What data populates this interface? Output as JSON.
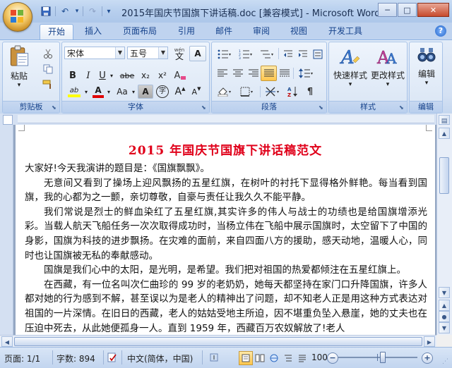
{
  "window": {
    "title": "2015年国庆节国旗下讲话稿.doc [兼容模式] - Microsoft Word",
    "min_glyph": "─",
    "max_glyph": "□",
    "close_glyph": "✕"
  },
  "qat": {
    "save": "💾",
    "undo": "↶",
    "undo_dd": "▾",
    "redo": "↷",
    "custom": "▾"
  },
  "tabs": [
    "开始",
    "插入",
    "页面布局",
    "引用",
    "邮件",
    "审阅",
    "视图",
    "开发工具"
  ],
  "help_glyph": "?",
  "ribbon": {
    "clipboard": {
      "label": "剪贴板",
      "paste": "粘贴",
      "paste_dd": "▾"
    },
    "font": {
      "label": "字体",
      "font_name": "宋体",
      "font_size": "五号",
      "bold": "B",
      "italic": "I",
      "underline": "U",
      "strike": "abe",
      "subscript": "x₂",
      "superscript": "x²",
      "clear": "A",
      "phonetic": "wén",
      "char_border": "A",
      "highlight": "ab",
      "font_color": "A",
      "case": "Aa",
      "char_shade": "A",
      "enclose": "字",
      "grow": "A",
      "shrink": "A"
    },
    "paragraph": {
      "label": "段落"
    },
    "styles": {
      "label": "样式",
      "quick_styles": "快速样式",
      "change_styles": "更改样式"
    },
    "editing": {
      "label": "编辑",
      "edit": "编辑"
    }
  },
  "document": {
    "title": "2015 年国庆节国旗下讲话稿范文",
    "paragraphs": [
      {
        "text": "大家好!今天我演讲的题目是：《国旗飘飘》。",
        "indent": false
      },
      {
        "text": "无意间又看到了操场上迎风飘扬的五星红旗，在树叶的衬托下显得格外鲜艳。每当看到国旗，我的心都为之一颤，亲切尊敬，自豪与责任让我久久不能平静。",
        "indent": true
      },
      {
        "text": "我们常说是烈士的鲜血染红了五星红旗,其实许多的伟人与战士的功绩也是给国旗增添光彩。当载人航天飞船任务一次次取得成功时，当杨立伟在飞船中展示国旗时，太空留下了中国的身影，国旗为科技的进步飘扬。在灾难的面前，来自四面八方的援助，感天动地，温暖人心，同时也让国旗被无私的奉献感动。",
        "indent": true
      },
      {
        "text": "国旗是我们心中的太阳，是光明，是希望。我们把对祖国的热爱都倾注在五星红旗上。",
        "indent": true
      },
      {
        "text": "在西藏，有一位名叫次仁曲珍的 99 岁的老奶奶，她每天都坚持在家门口升降国旗，许多人都对她的行为感到不解，甚至误以为是老人的精神出了问题，却不知老人正是用这种方式表达对祖国的一片深情。在旧日的西藏，老人的姑姑受地主所迫，因不堪重负坠入悬崖，她的丈夫也在压迫中死去，从此她便孤身一人。直到 1959 年，西藏百万农奴解放了!老人",
        "indent": true
      }
    ]
  },
  "status": {
    "page": "页面: 1/1",
    "words": "字数: 894",
    "lang": "中文(简体，中国)",
    "zoom": "100%",
    "zoom_minus": "−",
    "zoom_plus": "+",
    "zoom_fraction": 0.55
  },
  "scroll": {
    "up": "▲",
    "down": "▼",
    "left": "◀",
    "right": "▶",
    "prev": "▲",
    "next": "▼",
    "select": "●"
  },
  "colors": {
    "title_red": "#e0001a",
    "accent": "#15428b",
    "font_color_bar": "#e00000",
    "highlight_bar": "#ffff00"
  }
}
